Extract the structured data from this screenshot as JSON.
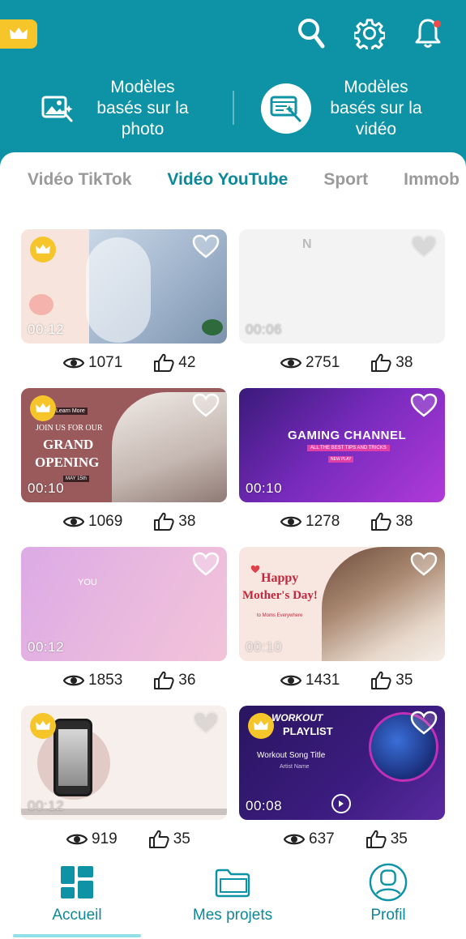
{
  "colors": {
    "accent": "#0e93a6",
    "accent_dark": "#0e8798",
    "premium": "#f6c52a",
    "notification": "#ef4b4b"
  },
  "header": {
    "premium_icon": "crown-icon",
    "icons": [
      "search-icon",
      "gear-icon",
      "bell-icon"
    ],
    "mode_tabs": [
      {
        "label": "Modèles\nbasés sur la\nphoto",
        "icon": "photo-magic-icon",
        "active": false
      },
      {
        "label": "Modèles\nbasés sur la\nvidéo",
        "icon": "video-magic-icon",
        "active": true
      }
    ]
  },
  "categories": [
    {
      "label": "Vidéo TikTok",
      "active": false
    },
    {
      "label": "Vidéo YouTube",
      "active": true
    },
    {
      "label": "Sport",
      "active": false
    },
    {
      "label": "Immob",
      "active": false
    }
  ],
  "templates": [
    {
      "duration": "00:12",
      "views": "1071",
      "likes": "42",
      "premium": true
    },
    {
      "duration": "00:06",
      "views": "2751",
      "likes": "38",
      "premium": false,
      "thumb_text": "N"
    },
    {
      "duration": "00:10",
      "views": "1069",
      "likes": "38",
      "premium": true,
      "thumb_lines": [
        "Learn More",
        "JOIN US FOR OUR",
        "GRAND",
        "OPENING",
        "MAY 15th"
      ]
    },
    {
      "duration": "00:10",
      "views": "1278",
      "likes": "38",
      "premium": false,
      "thumb_lines": [
        "GAMING CHANNEL",
        "ALL THE BEST TIPS AND TRICKS",
        "NEW PLAY"
      ]
    },
    {
      "duration": "00:12",
      "views": "1853",
      "likes": "36",
      "premium": false,
      "thumb_text": "YOU"
    },
    {
      "duration": "00:10",
      "views": "1431",
      "likes": "35",
      "premium": false,
      "thumb_lines": [
        "Happy",
        "Mother's Day!",
        "to Moms Everywhere"
      ]
    },
    {
      "duration": "00:12",
      "views": "919",
      "likes": "35",
      "premium": true
    },
    {
      "duration": "00:08",
      "views": "637",
      "likes": "35",
      "premium": true,
      "thumb_lines": [
        "WORKOUT",
        "PLAYLIST",
        "Workout Song Title",
        "Artist Name"
      ]
    }
  ],
  "bottom_nav": [
    {
      "label": "Accueil",
      "icon": "grid-icon",
      "active": true
    },
    {
      "label": "Mes projets",
      "icon": "folder-icon",
      "active": false
    },
    {
      "label": "Profil",
      "icon": "profile-icon",
      "active": false
    }
  ]
}
